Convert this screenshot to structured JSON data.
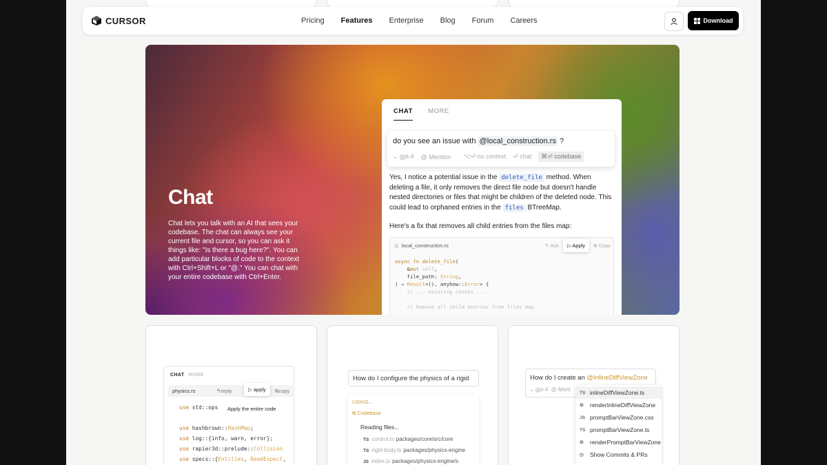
{
  "nav": {
    "logo_text": "CURSOR",
    "links": [
      "Pricing",
      "Features",
      "Enterprise",
      "Blog",
      "Forum",
      "Careers"
    ],
    "active_link": "Features",
    "download_label": "Download"
  },
  "hero": {
    "title": "Chat",
    "description": "Chat lets you talk with an AI that sees your codebase. The chat can always see your current file and cursor, so you can ask it things like: \"Is there a bug here?\". You can add particular blocks of code to the context with Ctrl+Shift+L or \"@.\" You can chat with your entire codebase with Ctrl+Enter."
  },
  "panel": {
    "tab_chat": "CHAT",
    "tab_more": "MORE",
    "query_prefix": "do you see an issue with",
    "query_mention": "@local_construction.rs",
    "query_suffix": "?",
    "opt_model": "gpt-4",
    "opt_mention": "@ Mention",
    "opt_nocontext": "⌥⏎ no context",
    "opt_chat": "⏎ chat",
    "opt_codebase": "⌘⏎ codebase",
    "answer_1": "Yes, I notice a potential issue in the",
    "answer_code_1": "delete_file",
    "answer_2": "method. When deleting a file, it only removes the direct file node but doesn't handle nested directories or files that might be children of the deleted node. This could lead to orphaned entries in the",
    "answer_code_2": "files",
    "answer_3": "BTreeMap.",
    "answer_fix": "Here's a fix that removes all child entries from the files map:",
    "code_filename": "local_construction.rs",
    "code_ask": "Ask",
    "code_apply": "Apply",
    "code_copy": "Copy"
  },
  "card1": {
    "tab_chat": "CHAT",
    "tab_more": "MORE",
    "filename": "physics.rs",
    "reply": "reply",
    "apply": "apply",
    "copy": "copy",
    "tooltip": "Apply the entire code"
  },
  "card2": {
    "query": "How do I configure the physics of a rigid",
    "using": "USING...",
    "codebase": "Codebase",
    "reading": "Reading files...",
    "files": [
      {
        "tag": "TS",
        "name": "control.ts",
        "path": "packages/core/src/core"
      },
      {
        "tag": "TS",
        "name": "rigid-body.ts",
        "path": "packages/physics-engine"
      },
      {
        "tag": "JS",
        "name": "index.js",
        "path": "packages/physics-engine/s"
      }
    ]
  },
  "card3": {
    "query_prefix": "How do I create an",
    "query_mention": "@InlineDiffViewZone",
    "opt_model": "gpt-4",
    "opt_mention": "@ Ment",
    "items": [
      {
        "icon": "TS",
        "label": "inlineDiffViewZone.ts"
      },
      {
        "icon": "⚙",
        "label": "renderInlineDiffViewZone"
      },
      {
        "icon": "JS",
        "label": "promptBarViewZone.css"
      },
      {
        "icon": "TS",
        "label": "promptBarViewZone.ts"
      },
      {
        "icon": "⚙",
        "label": "renderPromptBarViewZone"
      },
      {
        "icon": "◷",
        "label": "Show Commits & PRs"
      }
    ]
  }
}
